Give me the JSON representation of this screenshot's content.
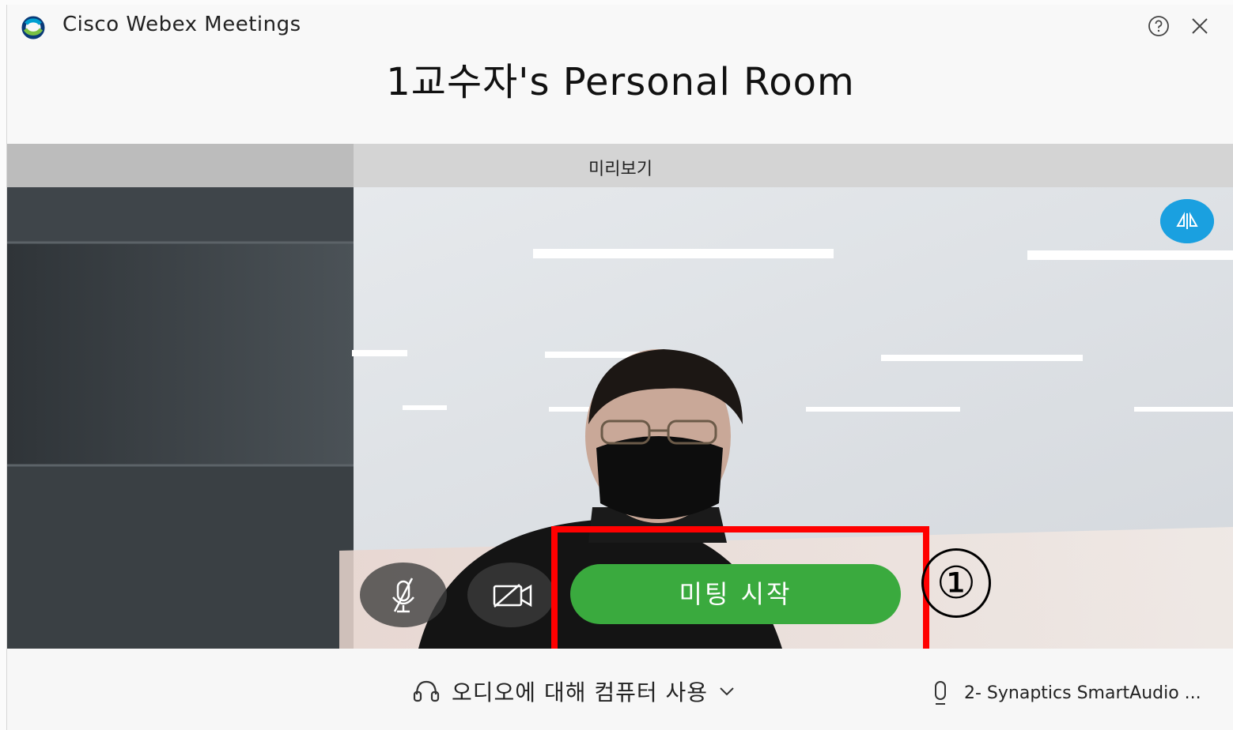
{
  "titlebar": {
    "app_title": "Cisco Webex Meetings",
    "logo_icon": "webex-logo-icon",
    "help_icon": "help-circle-icon",
    "close_icon": "close-icon"
  },
  "room_title": "1교수자's Personal Room",
  "preview": {
    "label": "미리보기",
    "flip_icon": "mirror-flip-icon"
  },
  "controls": {
    "mic_icon": "microphone-muted-icon",
    "camera_icon": "camera-off-icon",
    "start_label": "미팅 시작"
  },
  "annotation": {
    "step_number": "①",
    "highlight_color": "#ff0000"
  },
  "bottombar": {
    "audio_label": "오디오에 대해 컴퓨터 사용",
    "audio_icon": "headset-icon",
    "device_label": "2- Synaptics SmartAudio ...",
    "device_icon": "microphone-icon"
  },
  "colors": {
    "start_button": "#3aaa3e",
    "flip_button": "#1aa0e0"
  }
}
